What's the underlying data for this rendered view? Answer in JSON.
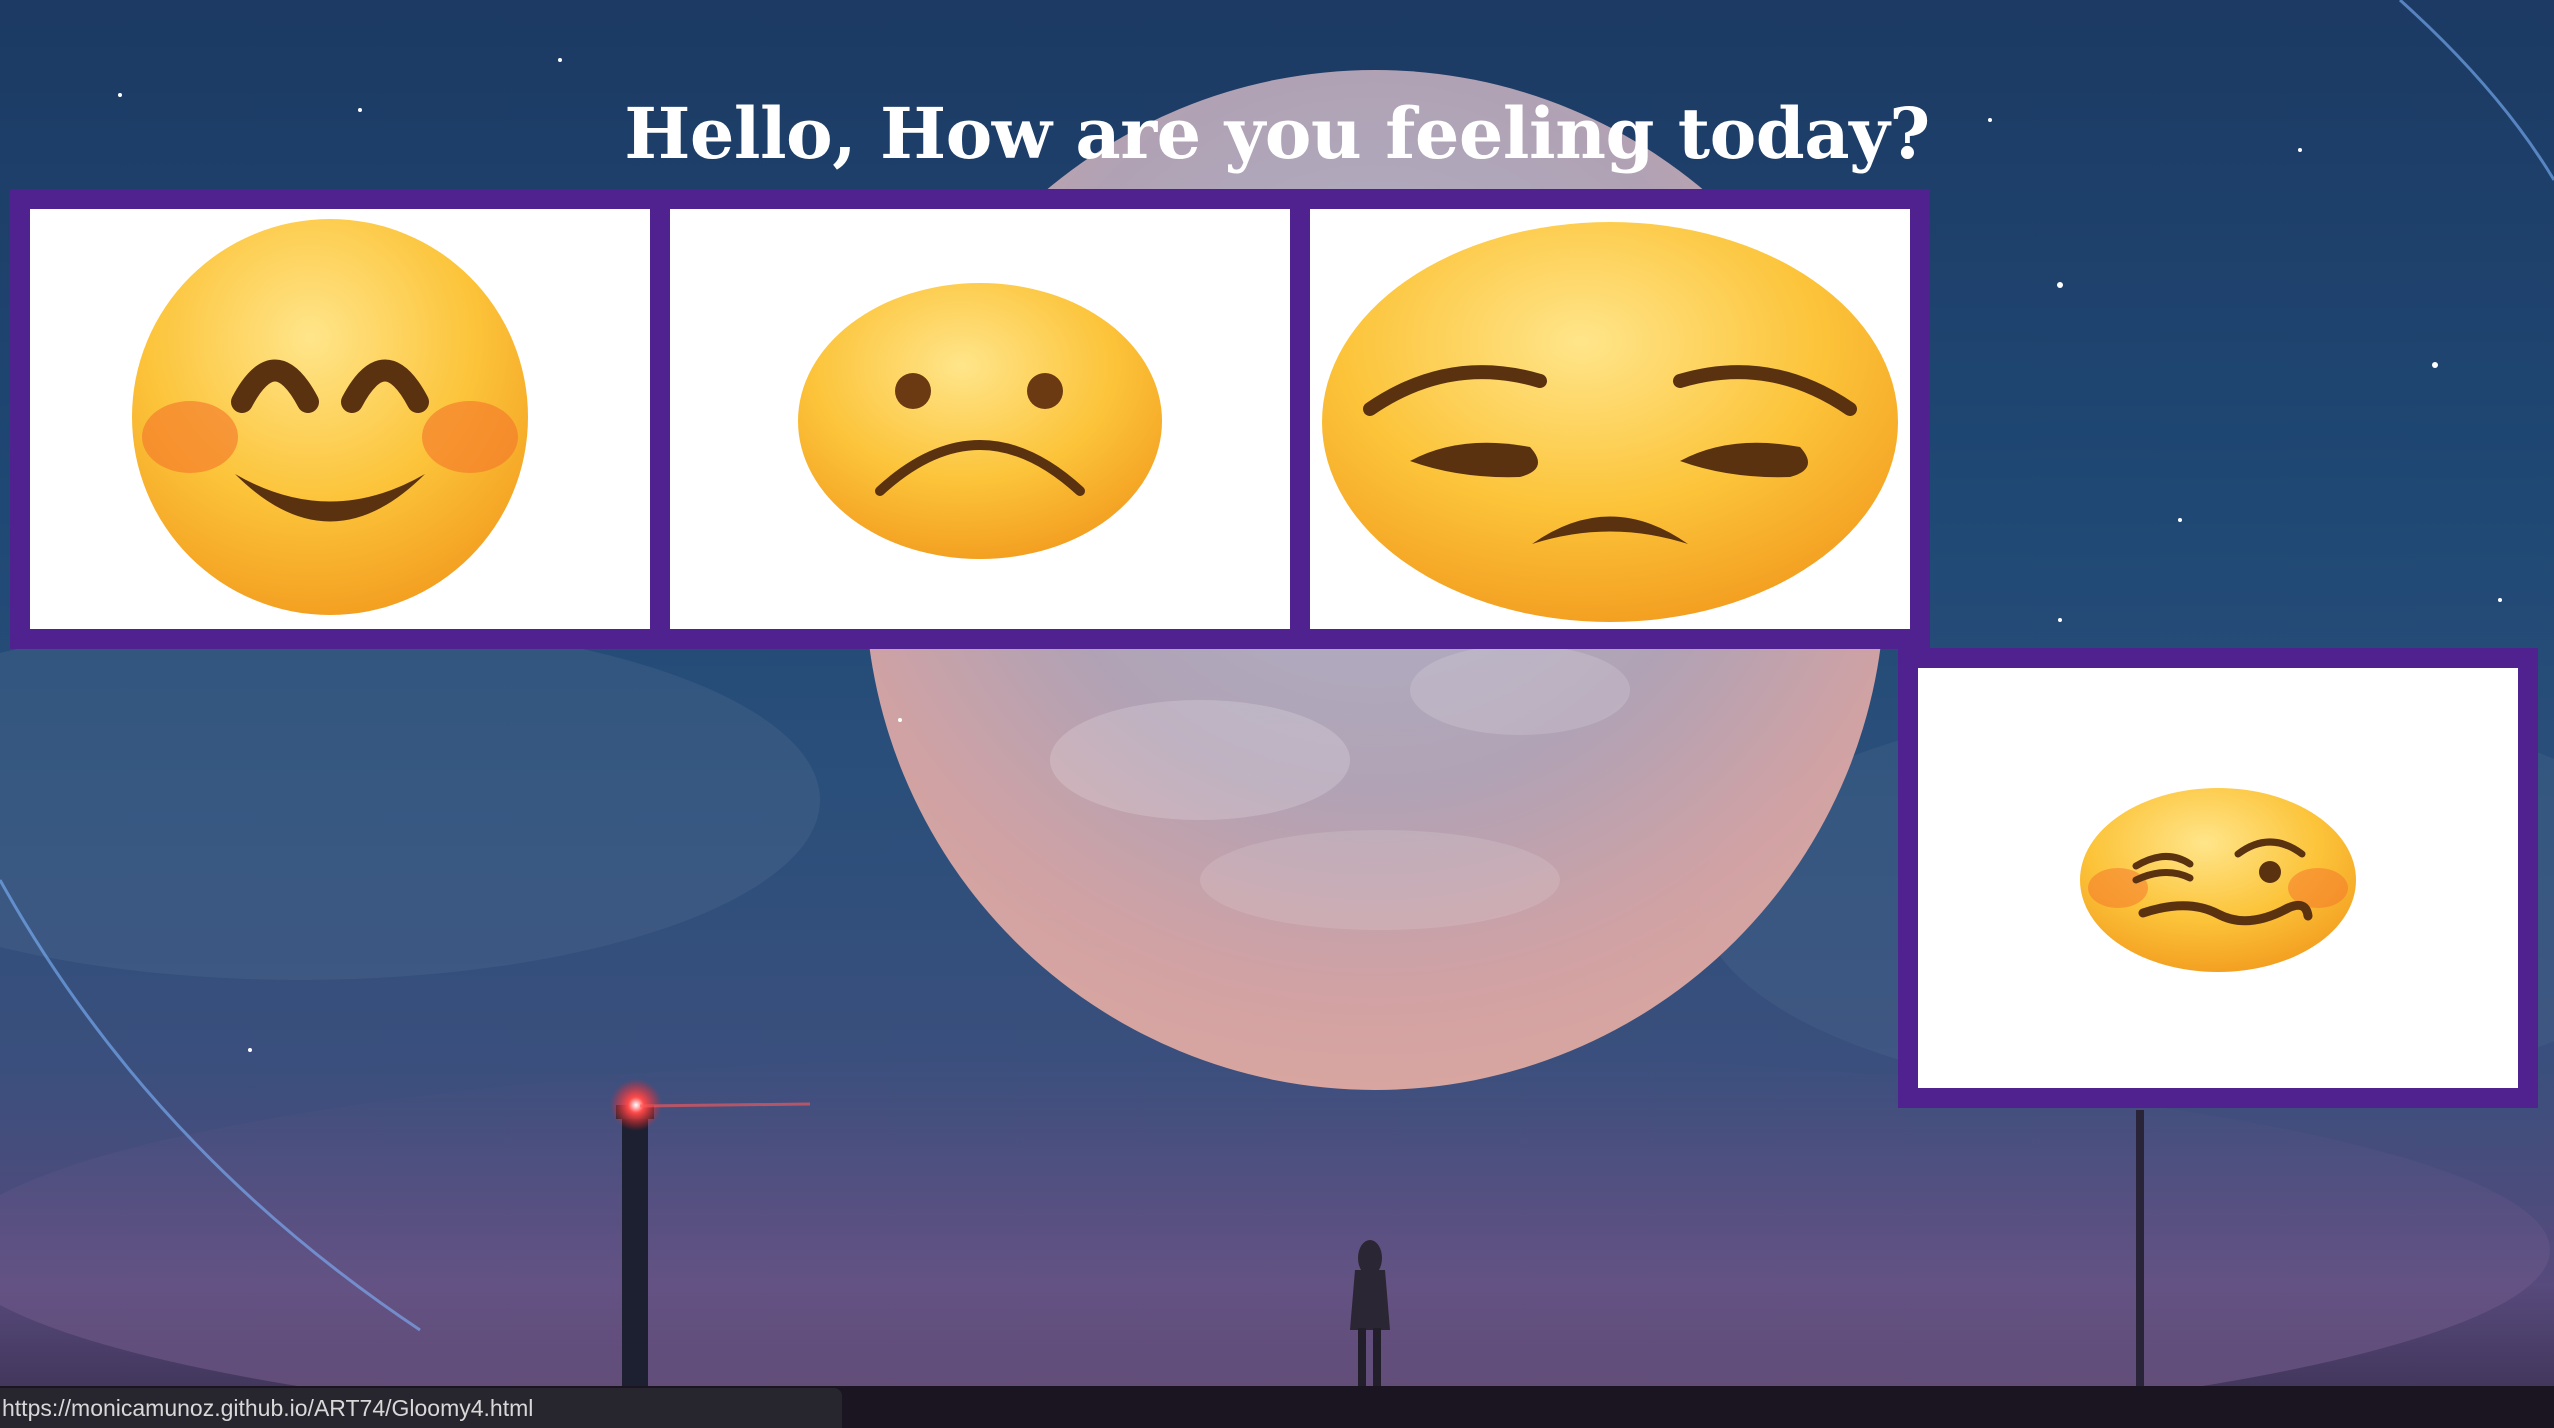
{
  "page": {
    "heading": "Hello, How are you feeling today?"
  },
  "colors": {
    "tile_border": "#4f2290",
    "tile_fill": "#ffffff",
    "heading": "#ffffff",
    "sky_top": "#1c3a63",
    "sky_bottom": "#574a7c"
  },
  "mood_tiles": [
    {
      "icon": "smiling-face-with-blushing-cheeks-icon"
    },
    {
      "icon": "frowning-face-icon"
    },
    {
      "icon": "unamused-face-icon"
    },
    {
      "icon": "woozy-face-icon"
    }
  ],
  "status_bar": {
    "url": "https://monicamunoz.github.io/ART74/Gloomy4.html"
  }
}
